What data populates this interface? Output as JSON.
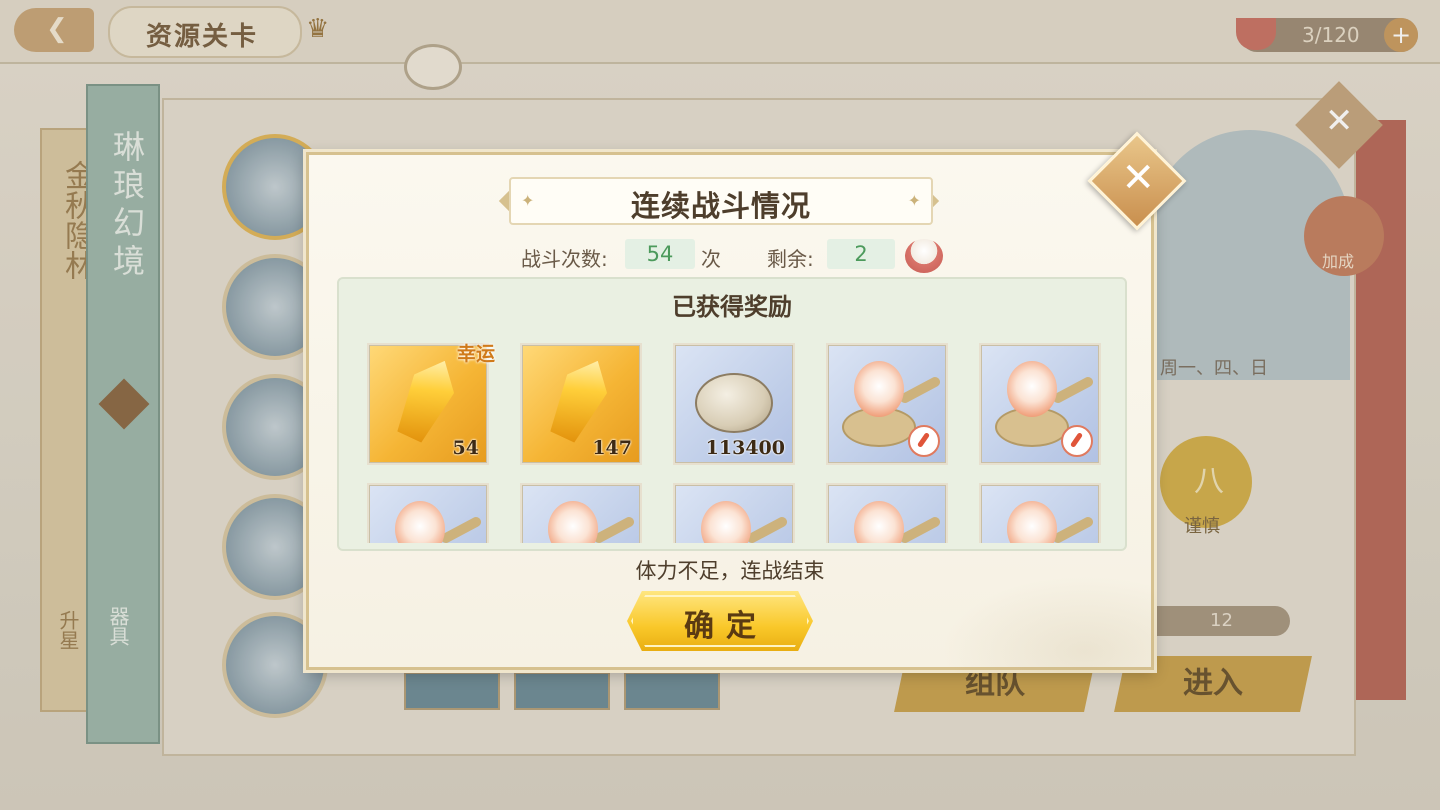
{
  "header": {
    "back_icon": "back-arrow-icon",
    "title": "资源关卡",
    "crown_icon": "crown-icon",
    "stamina": {
      "icon": "rice-bowl-icon",
      "text": "3/120",
      "plus": "+"
    }
  },
  "background": {
    "side_tab_1": {
      "text": "金秋隐林",
      "bottom": "升星"
    },
    "side_tab_2": {
      "text": "琳琅幻境",
      "bottom": "器具"
    },
    "right_panel": {
      "days_text": "周一、四、日",
      "bonus_label": "加成",
      "difficulty_char": "八",
      "difficulty_label": "谨慎",
      "cost": "12",
      "team_button": "组队",
      "enter_button": "进入"
    }
  },
  "modal": {
    "title": "连续战斗情况",
    "battle_count_label": "战斗次数:",
    "battle_count": "54",
    "battle_count_unit": "次",
    "remaining_label": "剩余:",
    "remaining": "2",
    "rewards_title": "已获得奖励",
    "rewards": [
      {
        "type": "gold-crystal",
        "qty": "54",
        "tag": "幸运",
        "bg": "gold"
      },
      {
        "type": "gold-crystal",
        "qty": "147",
        "tag": "",
        "bg": "gold"
      },
      {
        "type": "shell",
        "qty": "113400",
        "tag": "",
        "bg": "blue"
      },
      {
        "type": "spirit-spoon",
        "qty": "",
        "tag": "",
        "bg": "blue",
        "badge": true
      },
      {
        "type": "spirit-spoon",
        "qty": "",
        "tag": "",
        "bg": "blue",
        "badge": true
      },
      {
        "type": "spirit-spoon",
        "qty": "",
        "tag": "",
        "bg": "blue"
      },
      {
        "type": "spirit-spoon",
        "qty": "",
        "tag": "",
        "bg": "blue"
      },
      {
        "type": "spirit-spoon",
        "qty": "",
        "tag": "",
        "bg": "blue"
      },
      {
        "type": "spirit-spoon",
        "qty": "",
        "tag": "",
        "bg": "blue"
      },
      {
        "type": "spirit-spoon",
        "qty": "",
        "tag": "",
        "bg": "blue"
      }
    ],
    "end_message": "体力不足，连战结束",
    "confirm_button": "确定",
    "close_icon": "close-x-icon"
  },
  "colors": {
    "accent_gold": "#f9c82a",
    "value_green": "#4c9a5c",
    "lucky_orange": "#d07a1a"
  }
}
